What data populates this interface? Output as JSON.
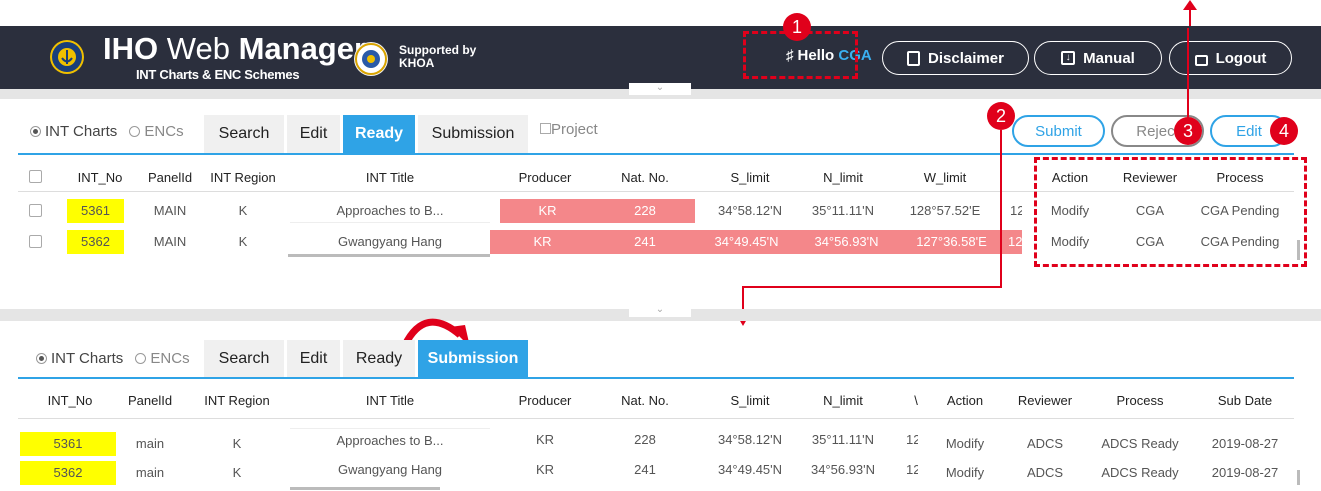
{
  "header": {
    "app_title_bold": "IHO",
    "app_title_light": "Web",
    "app_title_bold2": "Manager",
    "app_subtitle": "INT Charts & ENC Schemes",
    "supported_by": "Supported by",
    "supporter": "KHOA",
    "hello_prefix": "Hello",
    "hello_user": "CGA",
    "disclaimer": "Disclaimer",
    "manual": "Manual",
    "logout": "Logout"
  },
  "badges": [
    "1",
    "2",
    "3",
    "4"
  ],
  "top_panel": {
    "radio_int": "INT Charts",
    "radio_enc": "ENCs",
    "tabs": [
      "Search",
      "Edit",
      "Ready",
      "Submission"
    ],
    "active_tab": "Ready",
    "project": "Project",
    "submit": "Submit",
    "reject": "Reject",
    "edit": "Edit",
    "columns": [
      "INT_No",
      "PanelId",
      "INT Region",
      "INT Title",
      "Producer",
      "Nat. No.",
      "S_limit",
      "N_limit",
      "W_limit",
      "Action",
      "Reviewer",
      "Process"
    ],
    "rows": [
      {
        "int_no": "5361",
        "panel": "MAIN",
        "region": "K",
        "title": "Approaches to B...",
        "producer": "KR",
        "nat": "228",
        "s": "34°58.12'N",
        "n": "35°11.11'N",
        "w": "128°57.52'E",
        "cut": "12",
        "action": "Modify",
        "reviewer": "CGA",
        "process": "CGA Pending"
      },
      {
        "int_no": "5362",
        "panel": "MAIN",
        "region": "K",
        "title": "Gwangyang Hang",
        "producer": "KR",
        "nat": "241",
        "s": "34°49.45'N",
        "n": "34°56.93'N",
        "w": "127°36.58'E",
        "cut": "12",
        "action": "Modify",
        "reviewer": "CGA",
        "process": "CGA Pending"
      }
    ]
  },
  "bottom_panel": {
    "radio_int": "INT Charts",
    "radio_enc": "ENCs",
    "tabs": [
      "Search",
      "Edit",
      "Ready",
      "Submission"
    ],
    "active_tab": "Submission",
    "columns": [
      "INT_No",
      "PanelId",
      "INT Region",
      "INT Title",
      "Producer",
      "Nat. No.",
      "S_limit",
      "N_limit",
      "\\",
      "Action",
      "Reviewer",
      "Process",
      "Sub Date"
    ],
    "rows": [
      {
        "int_no": "5361",
        "panel": "main",
        "region": "K",
        "title": "Approaches to B...",
        "producer": "KR",
        "nat": "228",
        "s": "34°58.12'N",
        "n": "35°11.11'N",
        "cut": "12",
        "action": "Modify",
        "reviewer": "ADCS",
        "process": "ADCS Ready",
        "date": "2019-08-27"
      },
      {
        "int_no": "5362",
        "panel": "main",
        "region": "K",
        "title": "Gwangyang Hang",
        "producer": "KR",
        "nat": "241",
        "s": "34°49.45'N",
        "n": "34°56.93'N",
        "cut": "12",
        "action": "Modify",
        "reviewer": "ADCS",
        "process": "ADCS Ready",
        "date": "2019-08-27"
      }
    ]
  },
  "colors": {
    "accent": "#2fa3e6",
    "header": "#2b2f3d",
    "annotation": "#e0001b",
    "highlight": "#ffff00",
    "row_pink": "#f4878a"
  }
}
